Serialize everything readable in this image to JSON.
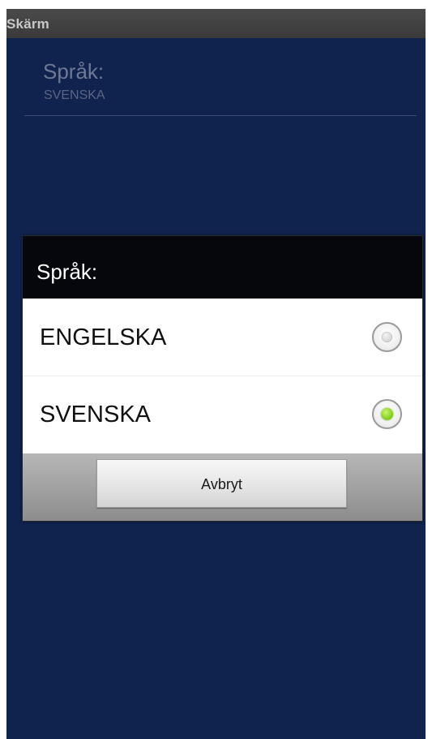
{
  "app": {
    "title": "Skärm"
  },
  "preference": {
    "title": "Språk:",
    "summary": "SVENSKA"
  },
  "dialog": {
    "title": "Språk:",
    "options": [
      {
        "label": "ENGELSKA",
        "checked": false
      },
      {
        "label": "SVENSKA",
        "checked": true
      }
    ],
    "cancel_label": "Avbryt"
  },
  "colors": {
    "background": "#10224e",
    "title_bar": "#404040",
    "dialog_header": "#05070c",
    "radio_selected": "#7cc91e"
  }
}
